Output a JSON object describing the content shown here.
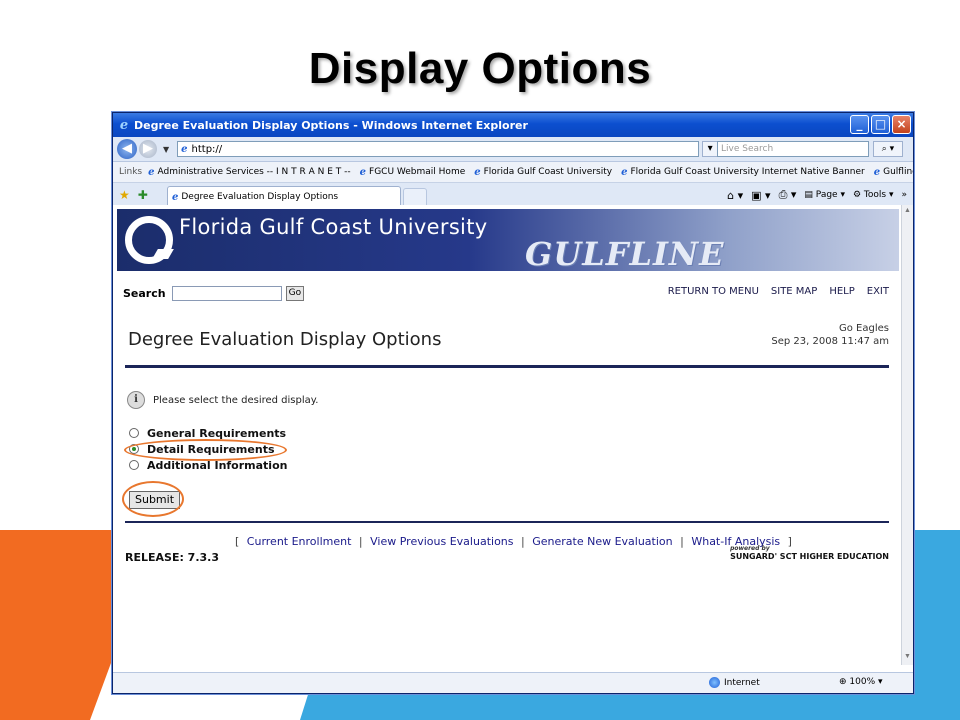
{
  "slide": {
    "title": "Display Options",
    "colors": {
      "orange": "#f26b21",
      "blue": "#3aa8e0"
    }
  },
  "browser": {
    "window_title": "Degree Evaluation Display Options - Windows Internet Explorer",
    "address": "http://",
    "search_placeholder": "Live Search",
    "links_label": "Links",
    "links": [
      "Administrative Services -- I N T R A N E T --",
      "FGCU Webmail Home",
      "Florida Gulf Coast University",
      "Florida Gulf Coast University Internet Native Banner",
      "Gulfline"
    ],
    "tab_title": "Degree Evaluation Display Options",
    "commands": {
      "page": "Page",
      "tools": "Tools"
    },
    "status": {
      "zone": "Internet",
      "zoom": "100%"
    }
  },
  "page": {
    "banner": {
      "university": "Florida Gulf Coast University",
      "system": "GULFLINE"
    },
    "search_label": "Search",
    "go_label": "Go",
    "topnav": [
      "RETURN TO MENU",
      "SITE MAP",
      "HELP",
      "EXIT"
    ],
    "title": "Degree Evaluation Display Options",
    "greeting": "Go Eagles",
    "datetime": "Sep 23, 2008 11:47 am",
    "info": "Please select the desired display.",
    "options": [
      {
        "label": "General Requirements",
        "selected": false
      },
      {
        "label": "Detail Requirements",
        "selected": true
      },
      {
        "label": "Additional Information",
        "selected": false
      }
    ],
    "submit": "Submit",
    "bottom_links": [
      "Current Enrollment",
      "View Previous Evaluations",
      "Generate New Evaluation",
      "What-If Analysis"
    ],
    "release": "RELEASE: 7.3.3",
    "powered_by": "powered by",
    "powered_brand": "SUNGARD' SCT HIGHER EDUCATION"
  }
}
